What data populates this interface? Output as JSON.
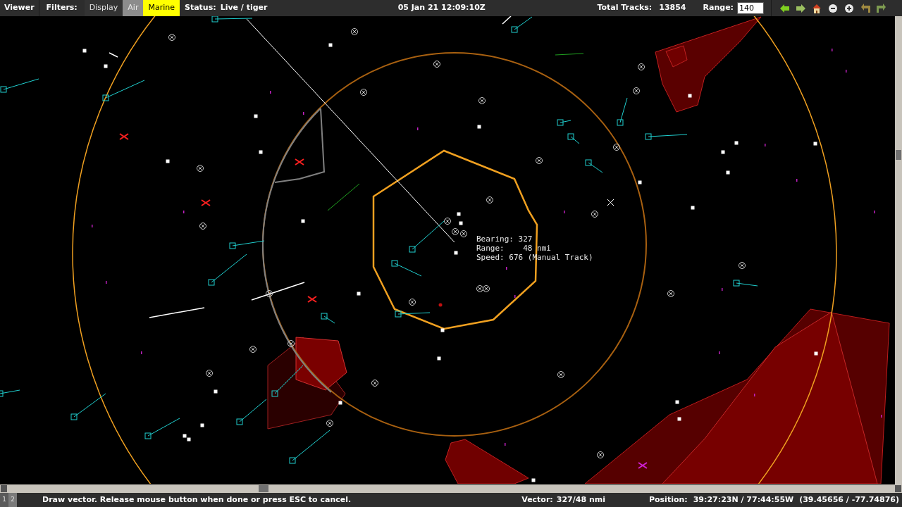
{
  "toolbar": {
    "menu": "Viewer",
    "filters_label": "Filters:",
    "filters": [
      {
        "label": "Display",
        "kind": "button"
      },
      {
        "label": "Air",
        "kind": "toggle",
        "on": false
      },
      {
        "label": "Marine",
        "kind": "toggle",
        "on": true
      }
    ],
    "status_label": "Status:",
    "status_value": "Live / tiger",
    "time": "05 Jan 21 12:09:10Z",
    "tracks_label": "Total Tracks:",
    "tracks_value": "13854",
    "range_label": "Range:",
    "range_value": "140",
    "nav": [
      {
        "kind": "back",
        "disabled": false
      },
      {
        "kind": "forward",
        "disabled": true
      },
      {
        "kind": "home",
        "disabled": false
      },
      {
        "kind": "zoom-out",
        "disabled": false
      },
      {
        "kind": "zoom-in",
        "disabled": false
      },
      {
        "kind": "undo",
        "disabled": true
      },
      {
        "kind": "redo",
        "disabled": true
      }
    ]
  },
  "readout": [
    "Bearing: 327",
    "Range:    48 nmi",
    "Speed: 676 (Manual Track)"
  ],
  "status_bar": {
    "pages": [
      {
        "label": "1",
        "selected": true
      },
      {
        "label": "2",
        "selected": false
      }
    ],
    "message": "Draw vector. Release mouse button when done or press ESC to cancel.",
    "vector_label": "Vector:",
    "vector_value": "327/48 nmi",
    "position_label": "Position:",
    "position_value": "39:27:23N / 77:44:55W",
    "position_decimal": "(39.45656 / -77.74876)"
  }
}
